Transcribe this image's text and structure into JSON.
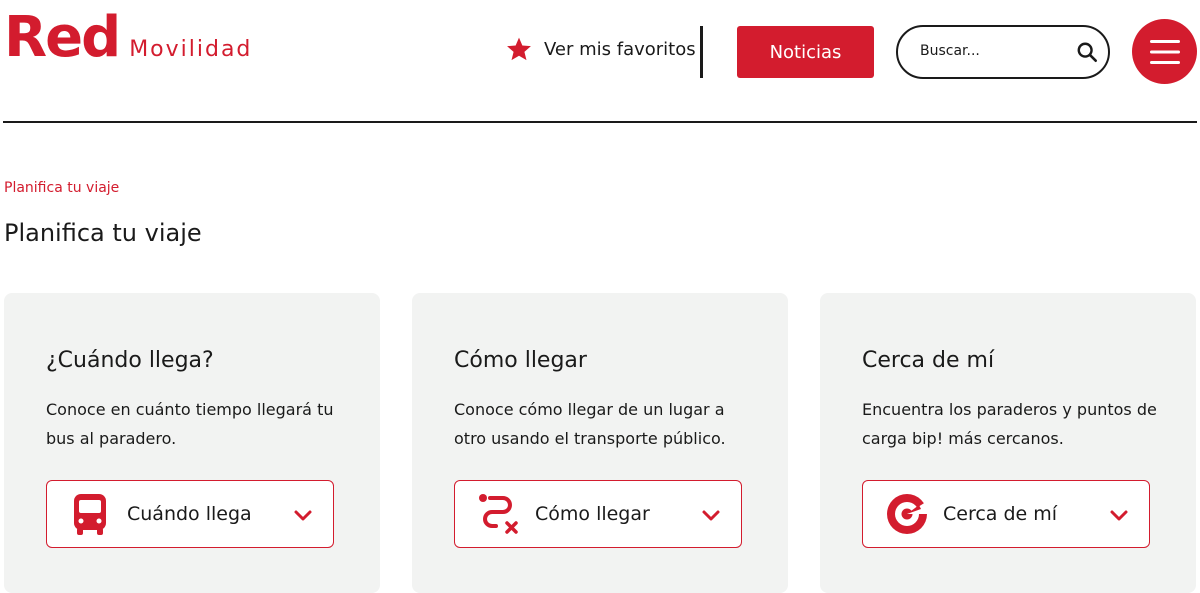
{
  "colors": {
    "accent": "#d31c2e",
    "card_bg": "#f2f3f2",
    "text": "#1a1a1a"
  },
  "header": {
    "logo": {
      "brand": "Red",
      "sub": "Movilidad"
    },
    "favorites_label": "Ver mis favoritos",
    "favorites_icon": "star-icon",
    "news_label": "Noticias",
    "search_placeholder": "Buscar...",
    "search_icon": "search-icon",
    "menu_icon": "hamburger-menu-icon"
  },
  "breadcrumb": "Planifica tu viaje",
  "page_title": "Planifica tu viaje",
  "cards": [
    {
      "title": "¿Cuándo llega?",
      "description": "Conoce en cuánto tiempo llegará tu bus al paradero.",
      "select_label": "Cuándo llega",
      "icon": "bus-icon"
    },
    {
      "title": "Cómo llegar",
      "description": "Conoce cómo llegar de un lugar a otro usando el transporte público.",
      "select_label": "Cómo llegar",
      "icon": "route-icon"
    },
    {
      "title": "Cerca de mí",
      "description": "Encuentra los paraderos y puntos de carga bip! más cercanos.",
      "select_label": "Cerca de mí",
      "icon": "nearby-icon"
    }
  ]
}
